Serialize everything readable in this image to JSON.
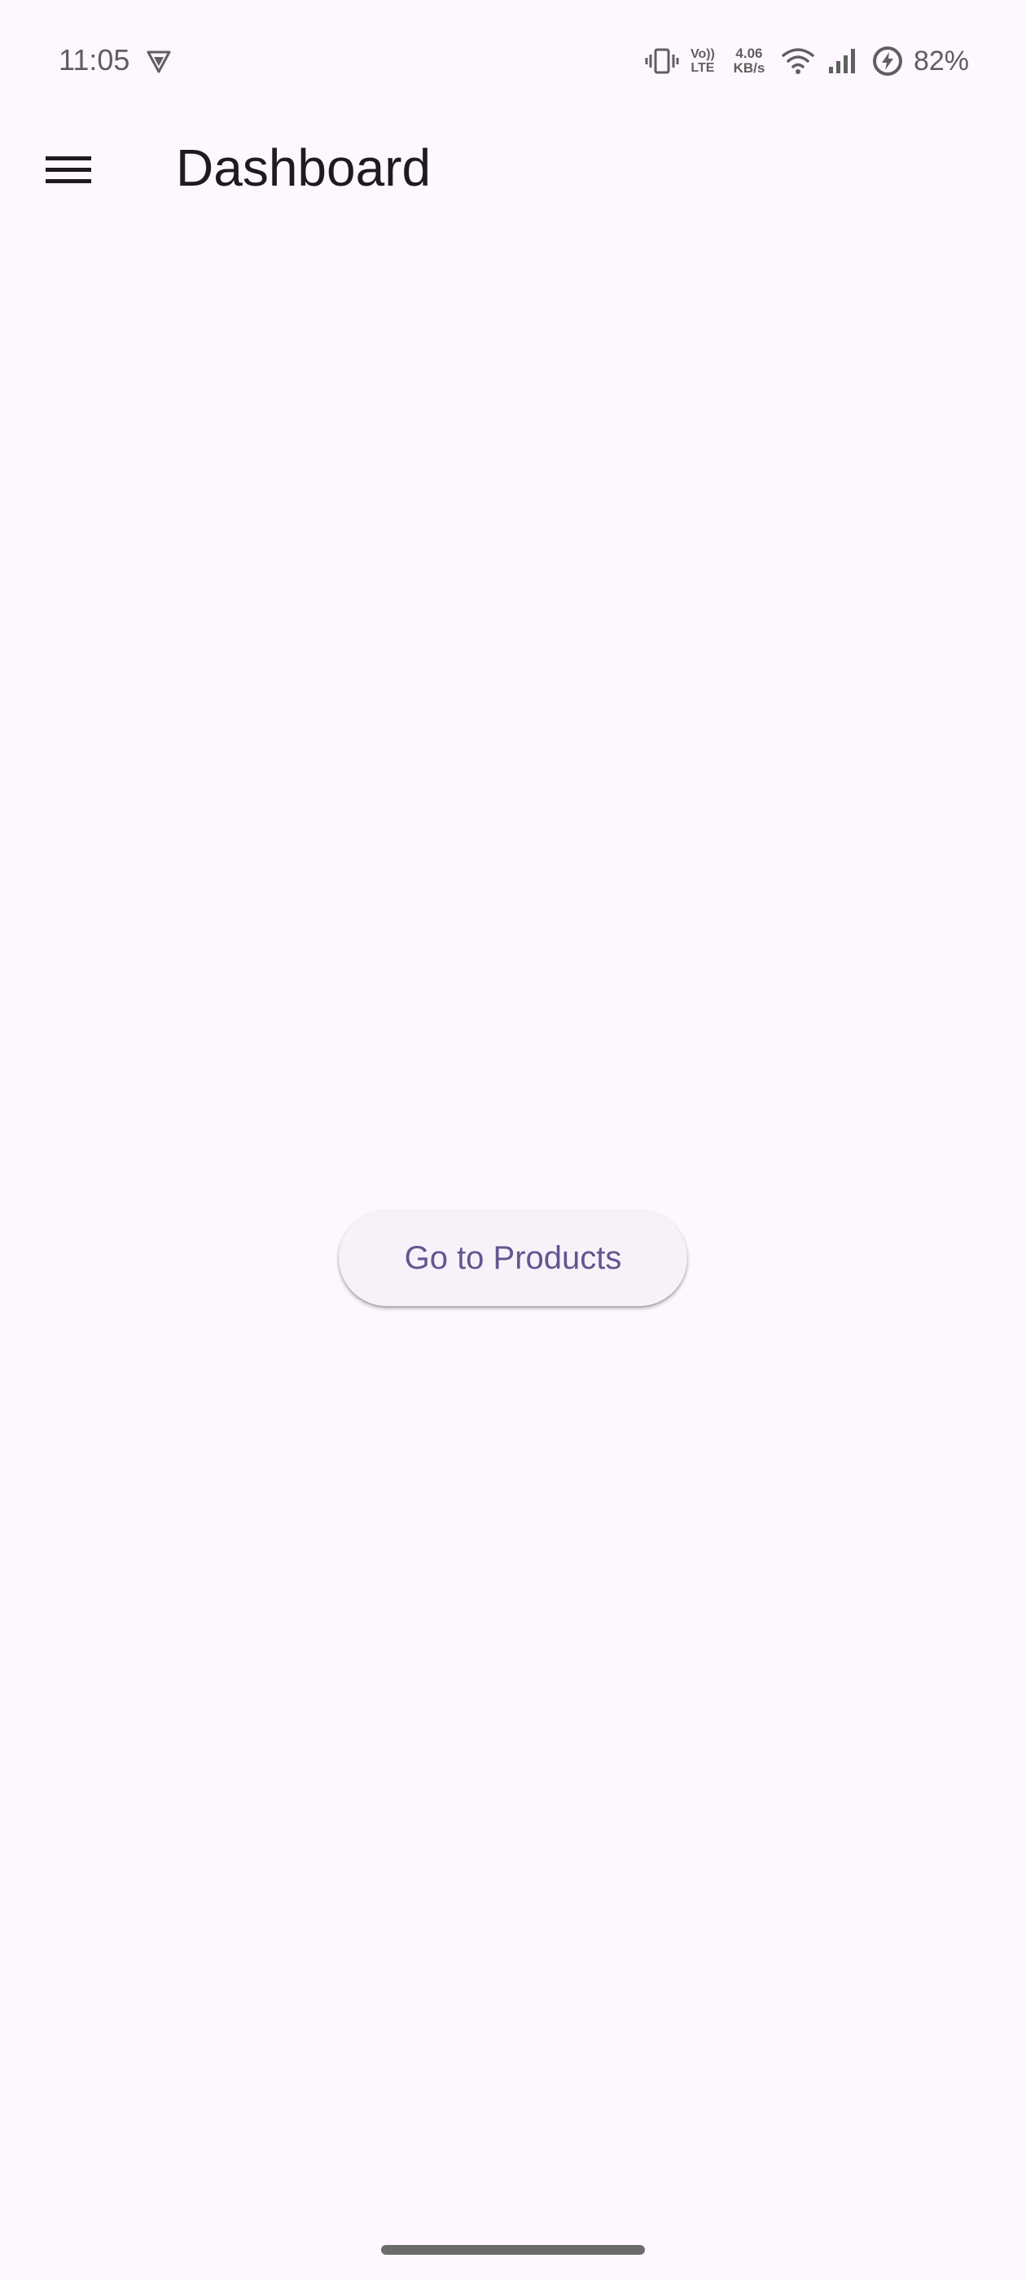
{
  "status_bar": {
    "time": "11:05",
    "volte_top": "Vo))",
    "volte_bottom": "LTE",
    "speed_value": "4.06",
    "speed_unit": "KB/s",
    "battery": "82%",
    "icons": [
      "vpn-shield-icon",
      "vibrate-icon",
      "wifi-icon",
      "cell-signal-icon",
      "battery-saver-icon"
    ]
  },
  "app_bar": {
    "menu_icon": "hamburger-menu-icon",
    "title": "Dashboard"
  },
  "main": {
    "go_products_label": "Go to Products"
  },
  "colors": {
    "background": "#FEF7FF",
    "button_background": "#F7F2FA",
    "button_text": "#65558F",
    "title_text": "#1D1B20"
  }
}
